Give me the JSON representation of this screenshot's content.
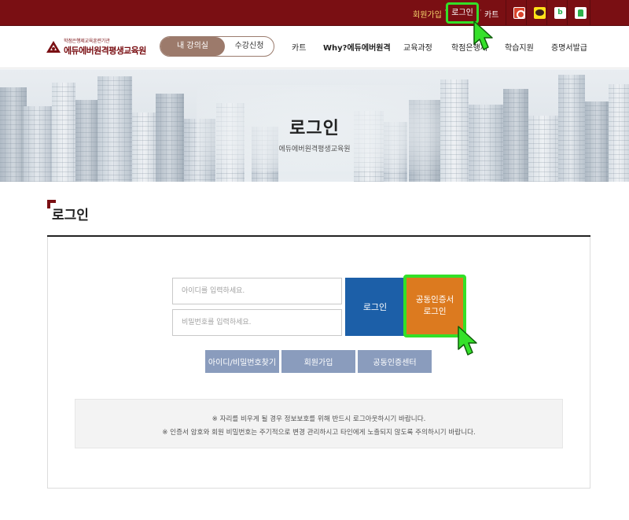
{
  "topbar": {
    "join_label": "회원가입",
    "login_label": "로그인",
    "cart_label": "카트",
    "icons": [
      "gear-icon",
      "kakao-icon",
      "blog-icon",
      "naver-icon"
    ],
    "colors": {
      "bar": "#7a0f13",
      "highlight": "#33e027"
    }
  },
  "header": {
    "logo_sub": "학점은행제교육훈련기관",
    "logo_main": "에듀에버원격평생교육원",
    "toggle": {
      "active": "내 강의실",
      "inactive": "수강신청"
    },
    "nav": [
      "카트",
      "Why?에듀에버원격",
      "교육과정",
      "학점은행제",
      "학습지원",
      "증명서발급"
    ]
  },
  "hero": {
    "title": "로그인",
    "subtitle": "에듀에버원격평생교육원"
  },
  "section": {
    "title": "로그인"
  },
  "login_form": {
    "id_placeholder": "아이디를 입력하세요.",
    "pw_placeholder": "비밀번호를 입력하세요.",
    "login_button": "로그인",
    "cert_button_line1": "공동인증서",
    "cert_button_line2": "로그인",
    "links": [
      "아이디/비밀번호찾기",
      "회원가입",
      "공동인증센터"
    ],
    "colors": {
      "login": "#1c5fa8",
      "cert": "#dc7a1f",
      "links": "#8a9cbd"
    }
  },
  "notice": {
    "line1": "※ 자리를 비우게 될 경우 정보보호를 위해 반드시 로그아웃하시기 바랍니다.",
    "line2": "※ 인증서 암호와 회원 비밀번호는 주기적으로 변경 관리하시고 타인에게 노출되지 않도록 주의하시기 바랍니다."
  }
}
